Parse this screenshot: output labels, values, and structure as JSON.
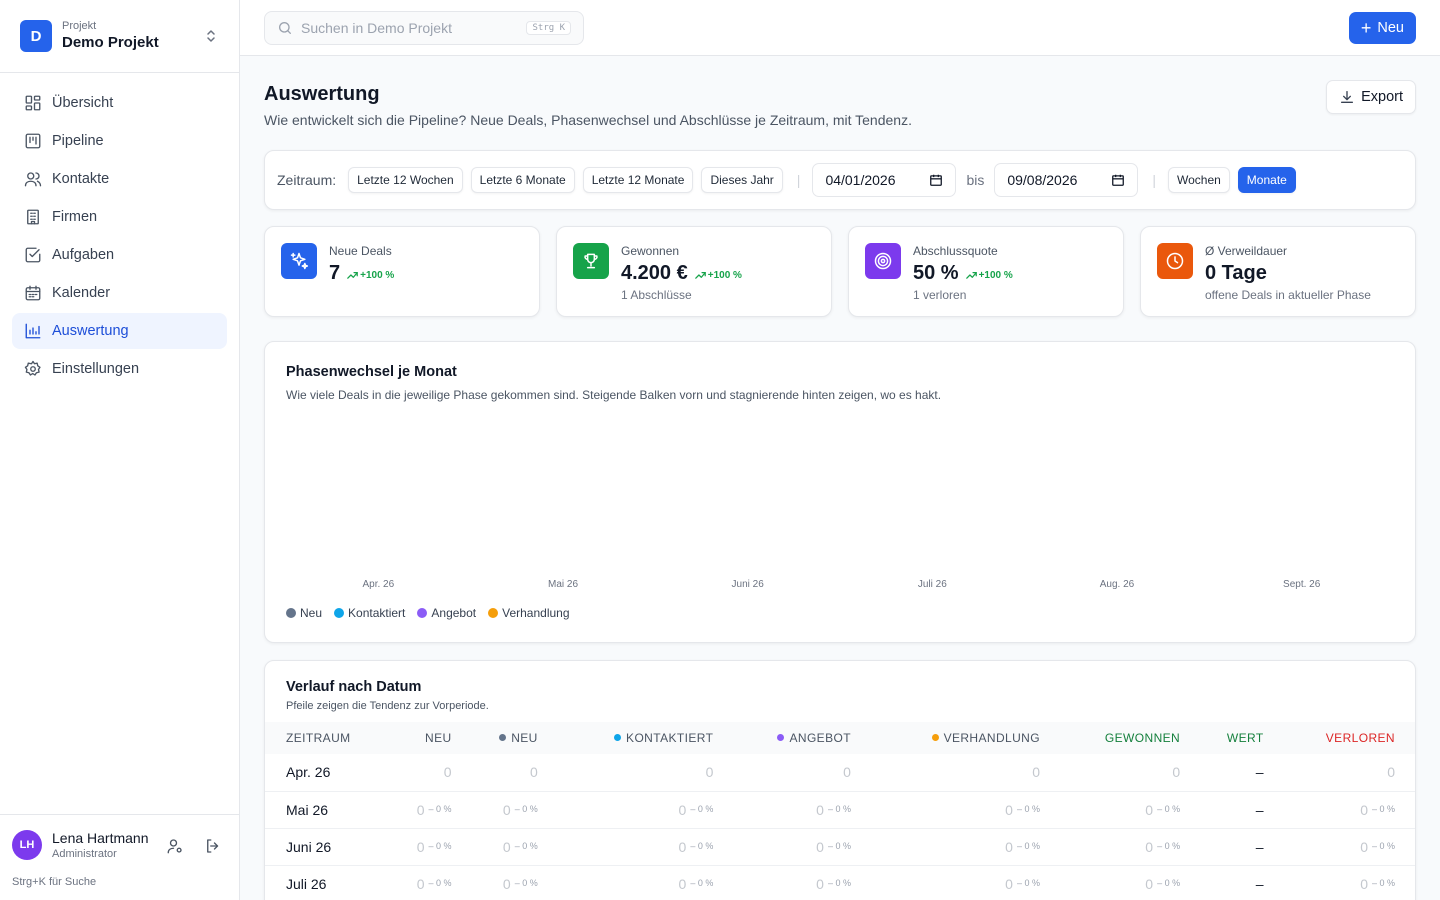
{
  "project": {
    "kicker": "Projekt",
    "name": "Demo Projekt",
    "initial": "D"
  },
  "nav": [
    {
      "label": "Übersicht",
      "icon": "dashboard-icon",
      "active": false
    },
    {
      "label": "Pipeline",
      "icon": "kanban-icon",
      "active": false
    },
    {
      "label": "Kontakte",
      "icon": "users-icon",
      "active": false
    },
    {
      "label": "Firmen",
      "icon": "building-icon",
      "active": false
    },
    {
      "label": "Aufgaben",
      "icon": "checkbox-icon",
      "active": false
    },
    {
      "label": "Kalender",
      "icon": "calendar-icon",
      "active": false
    },
    {
      "label": "Auswertung",
      "icon": "bar-chart-icon",
      "active": true
    },
    {
      "label": "Einstellungen",
      "icon": "gear-icon",
      "active": false
    }
  ],
  "user": {
    "initials": "LH",
    "name": "Lena Hartmann",
    "role": "Administrator",
    "hint": "Strg+K für Suche"
  },
  "topbar": {
    "search_placeholder": "Suchen in Demo Projekt",
    "search_shortcut": "Strg K",
    "new_label": "Neu"
  },
  "page": {
    "title": "Auswertung",
    "subtitle": "Wie entwickelt sich die Pipeline? Neue Deals, Phasenwechsel und Abschlüsse je Zeitraum, mit Tendenz.",
    "export_label": "Export"
  },
  "filters": {
    "label": "Zeitraum:",
    "presets": [
      "Letzte 12 Wochen",
      "Letzte 6 Monate",
      "Letzte 12 Monate",
      "Dieses Jahr"
    ],
    "from": "04/01/2026",
    "bis": "bis",
    "to": "09/08/2026",
    "granularity": [
      "Wochen",
      "Monate"
    ],
    "granularity_active": "Monate"
  },
  "kpis": [
    {
      "label": "Neue Deals",
      "value": "7",
      "trend": "+100 %",
      "sub": "",
      "color": "#2563eb",
      "icon": "sparkles-icon"
    },
    {
      "label": "Gewonnen",
      "value": "4.200 €",
      "trend": "+100 %",
      "sub": "1 Abschlüsse",
      "color": "#16a34a",
      "icon": "trophy-icon"
    },
    {
      "label": "Abschlussquote",
      "value": "50 %",
      "trend": "+100 %",
      "sub": "1 verloren",
      "color": "#7c3aed",
      "icon": "target-icon"
    },
    {
      "label": "Ø Verweildauer",
      "value": "0 Tage",
      "trend": "",
      "sub": "offene Deals in aktueller Phase",
      "color": "#ea580c",
      "icon": "clock-icon"
    }
  ],
  "chart": {
    "title": "Phasenwechsel je Monat",
    "subtitle": "Wie viele Deals in die jeweilige Phase gekommen sind. Steigende Balken vorn und stagnierende hinten zeigen, wo es hakt."
  },
  "chart_data": {
    "type": "bar",
    "categories": [
      "Apr. 26",
      "Mai 26",
      "Juni 26",
      "Juli 26",
      "Aug. 26",
      "Sept. 26"
    ],
    "series": [
      {
        "name": "Neu",
        "color": "#64748b",
        "values": [
          0,
          0,
          0,
          0,
          0,
          0
        ]
      },
      {
        "name": "Kontaktiert",
        "color": "#0ea5e9",
        "values": [
          0,
          0,
          0,
          0,
          0,
          0
        ]
      },
      {
        "name": "Angebot",
        "color": "#8b5cf6",
        "values": [
          0,
          0,
          0,
          0,
          0,
          0
        ]
      },
      {
        "name": "Verhandlung",
        "color": "#f59e0b",
        "values": [
          0,
          0,
          0,
          0,
          0,
          0
        ]
      }
    ],
    "legend": "bottom-left",
    "grid": false
  },
  "table": {
    "title": "Verlauf nach Datum",
    "subtitle": "Pfeile zeigen die Tendenz zur Vorperiode.",
    "headers": [
      {
        "label": "ZEITRAUM",
        "dot": "",
        "color": "#4b5563"
      },
      {
        "label": "NEU",
        "dot": "",
        "color": "#4b5563"
      },
      {
        "label": "NEU",
        "dot": "#64748b",
        "color": "#4b5563"
      },
      {
        "label": "KONTAKTIERT",
        "dot": "#0ea5e9",
        "color": "#4b5563"
      },
      {
        "label": "ANGEBOT",
        "dot": "#8b5cf6",
        "color": "#4b5563"
      },
      {
        "label": "VERHANDLUNG",
        "dot": "#f59e0b",
        "color": "#4b5563"
      },
      {
        "label": "GEWONNEN",
        "dot": "",
        "color": "#15803d"
      },
      {
        "label": "WERT",
        "dot": "",
        "color": "#15803d"
      },
      {
        "label": "VERLOREN",
        "dot": "",
        "color": "#dc2626"
      }
    ],
    "rows": [
      {
        "period": "Apr. 26",
        "cells": [
          {
            "v": "0",
            "d": ""
          },
          {
            "v": "0",
            "d": ""
          },
          {
            "v": "0",
            "d": ""
          },
          {
            "v": "0",
            "d": ""
          },
          {
            "v": "0",
            "d": ""
          },
          {
            "v": "0",
            "d": ""
          },
          {
            "v": "–",
            "d": ""
          },
          {
            "v": "0",
            "d": ""
          }
        ]
      },
      {
        "period": "Mai 26",
        "cells": [
          {
            "v": "0",
            "d": "– 0 %"
          },
          {
            "v": "0",
            "d": "– 0 %"
          },
          {
            "v": "0",
            "d": "– 0 %"
          },
          {
            "v": "0",
            "d": "– 0 %"
          },
          {
            "v": "0",
            "d": "– 0 %"
          },
          {
            "v": "0",
            "d": "– 0 %"
          },
          {
            "v": "–",
            "d": ""
          },
          {
            "v": "0",
            "d": "– 0 %"
          }
        ]
      },
      {
        "period": "Juni 26",
        "cells": [
          {
            "v": "0",
            "d": "– 0 %"
          },
          {
            "v": "0",
            "d": "– 0 %"
          },
          {
            "v": "0",
            "d": "– 0 %"
          },
          {
            "v": "0",
            "d": "– 0 %"
          },
          {
            "v": "0",
            "d": "– 0 %"
          },
          {
            "v": "0",
            "d": "– 0 %"
          },
          {
            "v": "–",
            "d": ""
          },
          {
            "v": "0",
            "d": "– 0 %"
          }
        ]
      },
      {
        "period": "Juli 26",
        "cells": [
          {
            "v": "0",
            "d": "– 0 %"
          },
          {
            "v": "0",
            "d": "– 0 %"
          },
          {
            "v": "0",
            "d": "– 0 %"
          },
          {
            "v": "0",
            "d": "– 0 %"
          },
          {
            "v": "0",
            "d": "– 0 %"
          },
          {
            "v": "0",
            "d": "– 0 %"
          },
          {
            "v": "–",
            "d": ""
          },
          {
            "v": "0",
            "d": "– 0 %"
          }
        ]
      }
    ]
  }
}
